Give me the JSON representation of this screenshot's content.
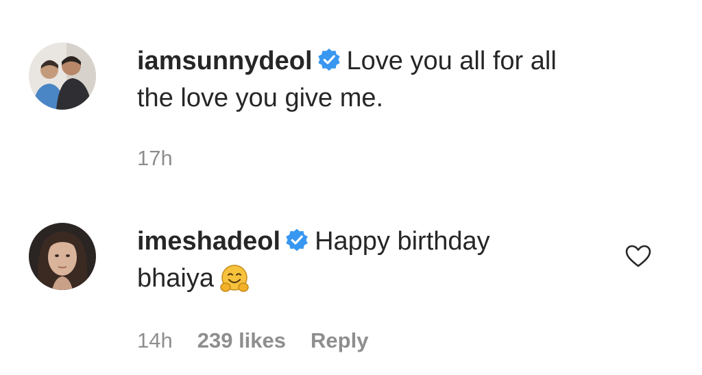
{
  "comments": [
    {
      "username": "iamsunnydeol",
      "text_line1": "Love you all for all",
      "text_line2": "the love you give me.",
      "time": "17h",
      "verified_icon": "verified-badge-icon",
      "avatar": "profile-photo-two-men"
    },
    {
      "username": "imeshadeol",
      "text_line1": "Happy birthday",
      "text_line2": "bhaiya",
      "time": "14h",
      "likes": "239 likes",
      "reply": "Reply",
      "verified_icon": "verified-badge-icon",
      "emoji": "hugging-face-emoji",
      "like_icon": "heart-outline-icon",
      "avatar": "profile-photo-woman"
    }
  ],
  "colors": {
    "text": "#262626",
    "meta": "#8e8e8e",
    "verified": "#3897f0"
  }
}
